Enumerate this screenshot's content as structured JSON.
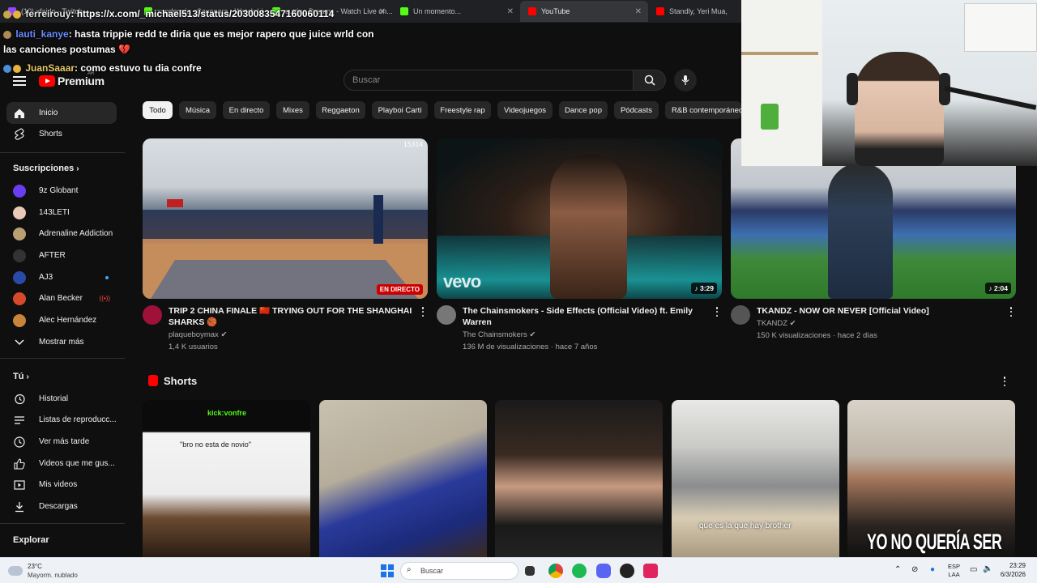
{
  "browser": {
    "tabs": [
      {
        "label": "(10) xfaido - Twitch",
        "color": "#9146ff"
      },
      {
        "label": "xander vic - Sayonara - Watch Live...",
        "color": "#53fc18"
      },
      {
        "label": "cutting Dreams - Watch Live on...",
        "color": "#53fc18"
      },
      {
        "label": "Un momento...",
        "color": "#53fc18"
      },
      {
        "label": "YouTube",
        "color": "#ff0000"
      },
      {
        "label": "Standly, Yeri Mua, Oscar...",
        "color": "#ff0000"
      }
    ]
  },
  "chat": [
    {
      "user": "ferreirouy",
      "text": ": https://x.com/_michael513/status/2030083547160060114"
    },
    {
      "user": "lauti_kanye",
      "text": ": hasta trippie redd te diria que es mejor rapero que juice wrld con"
    },
    {
      "user": "",
      "text": "las canciones postumas 💔"
    },
    {
      "user": "JuanSaaar",
      "text": ": como estuvo tu dia confre"
    }
  ],
  "masthead": {
    "logo": "Premium",
    "country": "AR",
    "search_placeholder": "Buscar"
  },
  "sidebar": {
    "main": [
      {
        "label": "Inicio",
        "icon": "home-icon"
      },
      {
        "label": "Shorts",
        "icon": "shorts-icon"
      }
    ],
    "subs_title": "Suscripciones",
    "subs": [
      {
        "label": "9z Globant",
        "color": "#6b3df0",
        "indicator": ""
      },
      {
        "label": "143LETI",
        "color": "#e9c9b9",
        "indicator": ""
      },
      {
        "label": "Adrenaline Addiction",
        "color": "#b8a070",
        "indicator": ""
      },
      {
        "label": "AFTER",
        "color": "#333333",
        "indicator": ""
      },
      {
        "label": "AJ3",
        "color": "#2a4aa8",
        "indicator": "dot"
      },
      {
        "label": "Alan Becker",
        "color": "#d64a2a",
        "indicator": "live"
      },
      {
        "label": "Alec Hernández",
        "color": "#c8853a",
        "indicator": ""
      }
    ],
    "more": "Mostrar más",
    "you_title": "Tú",
    "you": [
      {
        "label": "Historial",
        "icon": "history-icon"
      },
      {
        "label": "Listas de reproducc...",
        "icon": "playlist-icon"
      },
      {
        "label": "Ver más tarde",
        "icon": "clock-icon"
      },
      {
        "label": "Videos que me gus...",
        "icon": "thumbs-up-icon"
      },
      {
        "label": "Mis videos",
        "icon": "my-videos-icon"
      },
      {
        "label": "Descargas",
        "icon": "download-icon"
      }
    ],
    "explore_title": "Explorar"
  },
  "chips": [
    "Todo",
    "Música",
    "En directo",
    "Mixes",
    "Reggaeton",
    "Playboi Carti",
    "Freestyle rap",
    "Videojuegos",
    "Dance pop",
    "Pódcasts",
    "R&B contemporáneo"
  ],
  "videos": [
    {
      "title_line1": "TRIP 2 CHINA FINALE 🇨🇳 TRYING OUT FOR THE SHANGHAI",
      "title_line2": "SHARKS 🏀",
      "channel": "plaqueboymax",
      "meta": "1,4 K usuarios",
      "badge": "EN DIRECTO",
      "viewers": "15314"
    },
    {
      "title_line1": "The Chainsmokers - Side Effects (Official Video) ft. Emily",
      "title_line2": "Warren",
      "channel": "The Chainsmokers",
      "meta": "136 M de visualizaciones · hace 7 años",
      "badge": "3:29",
      "watermark": "vevo"
    },
    {
      "title_line1": "TKANDZ - NOW OR NEVER [Official Video]",
      "title_line2": "",
      "channel": "TKANDZ",
      "meta": "150 K visualizaciones · hace 2 días",
      "badge": "2:04"
    }
  ],
  "shorts": {
    "title": "Shorts",
    "items": [
      {
        "top_text": "kick:vonfre",
        "caption": "\"bro no esta de novio\""
      },
      {
        "caption": ""
      },
      {
        "caption": ""
      },
      {
        "caption": "que es la que hay brother"
      },
      {
        "caption": "YO NO QUERÍA SER"
      }
    ]
  },
  "taskbar": {
    "temp": "23°C",
    "weather": "Mayorm. nublado",
    "search": "Buscar",
    "lang1": "ESP",
    "lang2": "LAA",
    "time": "23:29",
    "date": "6/3/2026"
  }
}
